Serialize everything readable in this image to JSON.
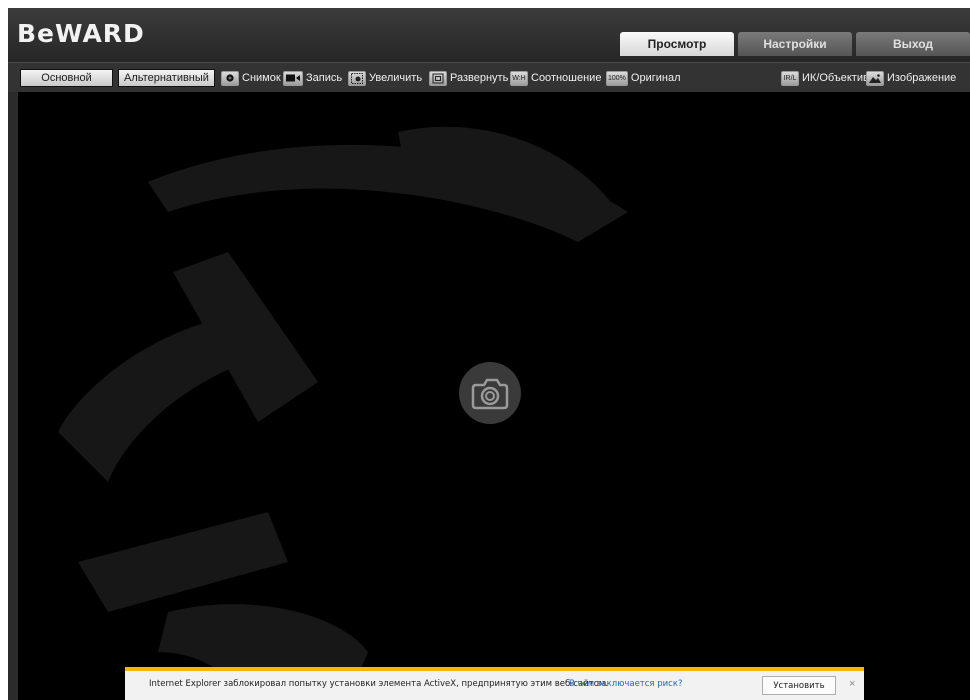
{
  "header": {
    "logo": "BeWARD",
    "tabs": [
      {
        "label": "Просмотр",
        "active": true
      },
      {
        "label": "Настройки",
        "active": false
      },
      {
        "label": "Выход",
        "active": false
      }
    ]
  },
  "toolbar": {
    "streams": {
      "main": "Основной",
      "alt": "Альтернативный"
    },
    "tools": {
      "snapshot": {
        "label": "Снимок",
        "icon": "camera-icon"
      },
      "record": {
        "label": "Запись",
        "icon": "video-camera-icon"
      },
      "zoom": {
        "label": "Увеличить",
        "icon": "zoom-icon"
      },
      "expand": {
        "label": "Развернуть",
        "icon": "fullscreen-icon"
      },
      "ratio": {
        "label": "Соотношение",
        "icon": "aspect-ratio-icon",
        "icon_text": "W:H"
      },
      "original": {
        "label": "Оригинал",
        "icon": "original-size-icon",
        "icon_text": "100%"
      },
      "ir": {
        "label": "ИК/Объектив",
        "icon": "ir-lens-icon",
        "icon_text": "IR/L"
      },
      "image": {
        "label": "Изображение",
        "icon": "image-icon"
      }
    }
  },
  "infobar": {
    "message": "Internet Explorer заблокировал попытку установки элемента ActiveX, предпринятую этим веб-сайтом.",
    "risk_link": "В чем заключается риск?",
    "install_button": "Установить",
    "close_glyph": "×"
  },
  "colors": {
    "background": "#2b2b2b",
    "video": "#000000",
    "active_tab": "#e6e6e6",
    "infobar_accent": "#f5b800",
    "link": "#1e64c8"
  }
}
